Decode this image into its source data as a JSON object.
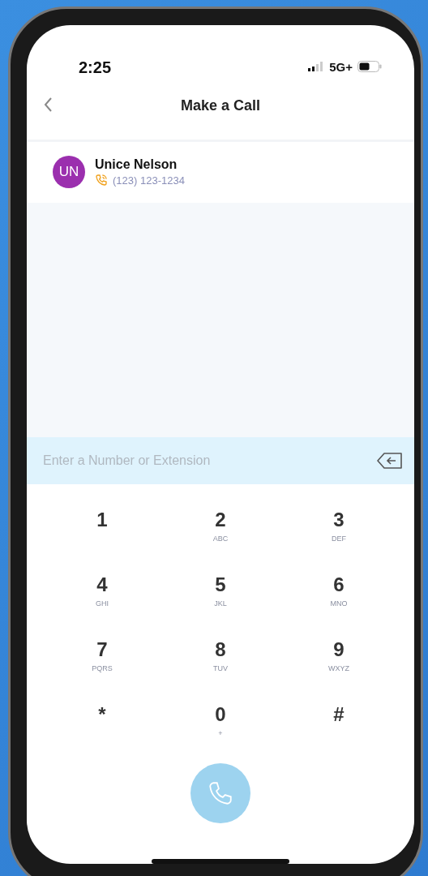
{
  "status_bar": {
    "time": "2:25",
    "network": "5G+"
  },
  "header": {
    "title": "Make a Call"
  },
  "contact": {
    "initials": "UN",
    "color": "#9b2fae",
    "name": "Unice Nelson",
    "phone": "(123) 123-1234"
  },
  "dial_field": {
    "placeholder": "Enter a Number or Extension"
  },
  "keypad": [
    {
      "digit": "1"
    },
    {
      "digit": "2",
      "letters": "ABC"
    },
    {
      "digit": "3",
      "letters": "DEF"
    },
    {
      "digit": "4",
      "letters": "GHI"
    },
    {
      "digit": "5",
      "letters": "JKL"
    },
    {
      "digit": "6",
      "letters": "MNO"
    },
    {
      "digit": "7",
      "letters": "PQRS"
    },
    {
      "digit": "8",
      "letters": "TUV"
    },
    {
      "digit": "9",
      "letters": "WXYZ"
    },
    {
      "digit": "*"
    },
    {
      "digit": "0",
      "letters": "+"
    },
    {
      "digit": "#"
    }
  ]
}
